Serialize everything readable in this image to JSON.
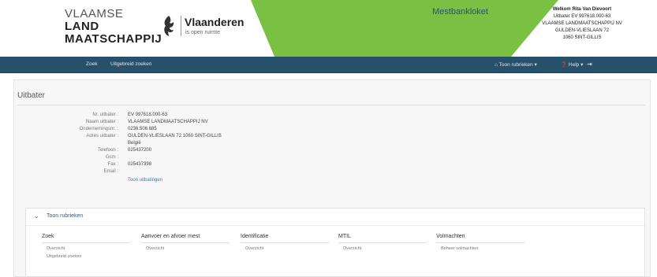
{
  "header": {
    "vlm_logo": [
      "VLAAMSE",
      "LAND",
      "MAATSCHAPPIJ"
    ],
    "vlaanderen_name": "Vlaanderen",
    "vlaanderen_tagline": "is open ruimte",
    "app_name": "Mestbankloket",
    "user": {
      "welcome": "Welkom Rita Van Dievoort",
      "lines": [
        "Uitbater EV 997618.000-63",
        "VLAAMSE LANDMAATSCHAPPIJ NV",
        "GULDEN-VLIESLAAN 72",
        "1060 SINT-GILLIS"
      ]
    },
    "band_color": "#7ac143"
  },
  "navbar": {
    "zoek": "Zoek",
    "uitgebreid": "Uitgebreid zoeken",
    "toon_rubrieken": "Toon rubrieken",
    "help": "Help",
    "home_icon": "home-icon",
    "help_icon": "help-circle-icon",
    "logout_icon": "logout-icon",
    "bg_color": "#27506a"
  },
  "panel": {
    "title": "Uitbater",
    "fields": [
      {
        "label": "Nr. uitbater :",
        "value": "EV 997618.000-63"
      },
      {
        "label": "Naam uitbater :",
        "value": "VLAAMSE LANDMAATSCHAPPIJ NV"
      },
      {
        "label": "Ondernemingsnr. :",
        "value": "0236.506.685"
      },
      {
        "label": "Adres uitbater :",
        "value": "GULDEN-VLIESLAAN 72 1060 SINT-GILLIS"
      },
      {
        "label": "",
        "value": "België"
      },
      {
        "label": "Telefoon :",
        "value": "025437200"
      },
      {
        "label": "Gsm :",
        "value": ""
      },
      {
        "label": "Fax :",
        "value": "025437398"
      },
      {
        "label": "Email :",
        "value": ""
      }
    ],
    "link": "Toon uitbatingen"
  },
  "rubrieken": {
    "toggle_label": "Toon rubrieken",
    "columns": [
      {
        "title": "Zoek",
        "items": [
          "Overzicht",
          "Uitgebreid zoeken"
        ]
      },
      {
        "title": "Aanvoer en afvoer mest",
        "items": [
          "Overzicht"
        ]
      },
      {
        "title": "Identificatie",
        "items": [
          "Overzicht"
        ]
      },
      {
        "title": "MTIL",
        "items": [
          "Overzicht"
        ]
      },
      {
        "title": "Volmachten",
        "items": [
          "Beheer volmachten"
        ]
      }
    ]
  }
}
